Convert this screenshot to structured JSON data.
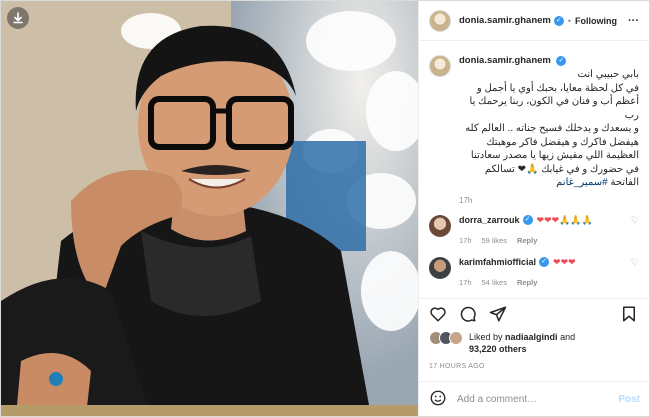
{
  "post": {
    "username": "donia.samir.ghanem",
    "follow_label": "Following",
    "dot": "•",
    "more": "···",
    "caption": "بابي حبيبي انت\nفي كل لحظة معايا، بحبك أوي يا أجمل و\nأعظم أب و فنان في الكون، ربنا يرحمك يا رب\nو يسعدك و يدخلك فسيح جناته .. العالم كله\nهيفضل فاكرك و هيفضل فاكر موهبتك\nالعظيمة اللي مفيش زيها يا مصدر سعادتنا\nفي حضورك و في غيابك 🙏❤ تسالكم\nالفاتحة",
    "hashtag": "#سمير_غانم",
    "caption_time": "17h"
  },
  "comments": [
    {
      "username": "dorra_zarrouk",
      "text": "❤❤❤🙏🙏🙏",
      "time": "17h",
      "likes": "59 likes",
      "reply": "Reply",
      "avatar_color": "#6b4a3a"
    },
    {
      "username": "karimfahmiofficial",
      "text": "❤❤❤",
      "time": "17h",
      "likes": "54 likes",
      "reply": "Reply",
      "avatar_color": "#3c3f44"
    }
  ],
  "likes": {
    "prefix": "Liked by",
    "name": "nadiaalgindi",
    "and": "and",
    "count": "93,220 others"
  },
  "post_time": "17 HOURS AGO",
  "add_comment": {
    "placeholder": "Add a comment…",
    "post_label": "Post"
  },
  "colors": {
    "verified": "#3897f0",
    "heart": "#ed4956",
    "link": "#00376b",
    "post_button": "#b3dbff"
  },
  "icons": [
    "download-icon",
    "heart-icon",
    "comment-icon",
    "share-icon",
    "bookmark-icon",
    "emoji-icon",
    "more-icon"
  ]
}
